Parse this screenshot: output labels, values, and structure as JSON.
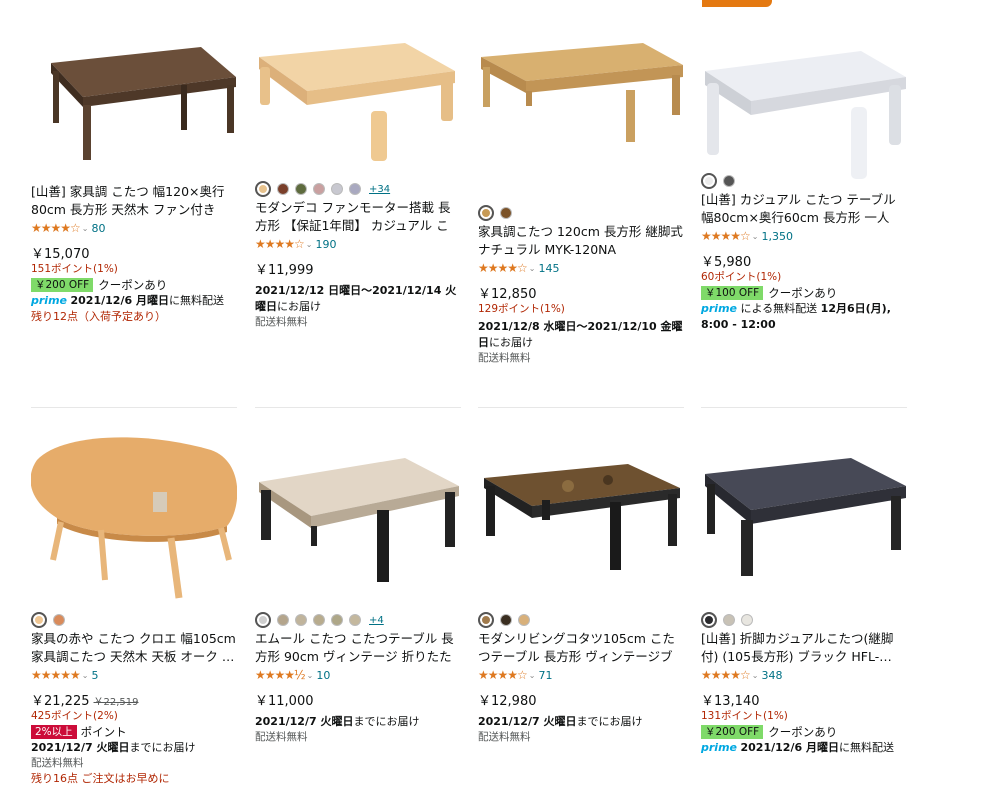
{
  "products": [
    {
      "title": "[山善] 家具調 こたつ 幅120×奥行80cm 長方形 天然木 ファン付きヒ…",
      "rating_count": "80",
      "price": "￥15,070",
      "points": "151ポイント(1%)",
      "coupon_badge": "￥200 OFF",
      "coupon_text": "クーポンあり",
      "prime_label": "prime",
      "delivery": "2021/12/6 月曜日",
      "delivery_suffix": "に無料配送",
      "stock": "残り12点（入荷予定あり）"
    },
    {
      "title": "モダンデコ ファンモーター搭載 長方形 【保証1年間】 カジュアル こた…",
      "more_colors": "+34",
      "rating_count": "190",
      "price": "￥11,999",
      "delivery": "2021/12/12 日曜日～2021/12/14 火曜日",
      "delivery_suffix": "にお届け",
      "shipping": "配送料無料"
    },
    {
      "title": "家具調こたつ 120cm 長方形 継脚式 ナチュラル MYK-120NA",
      "rating_count": "145",
      "price": "￥12,850",
      "points": "129ポイント(1%)",
      "delivery": "2021/12/8 水曜日～2021/12/10 金曜日",
      "delivery_suffix": "にお届け",
      "shipping": "配送料無料"
    },
    {
      "title": "[山善] カジュアル こたつ テーブル 幅80cm×奥行60cm 長方形 一人暮…",
      "rating_count": "1,350",
      "price": "￥5,980",
      "points": "60ポイント(1%)",
      "coupon_badge": "￥100 OFF",
      "coupon_text": "クーポンあり",
      "prime_label": "prime",
      "prime_text": "による無料配送",
      "delivery": "12月6日(月), 8:00 - 12:00"
    },
    {
      "title": "家具の赤や こたつ クロエ 幅105cm 家具調こたつ 天然木 天板 オーク …",
      "rating_count": "5",
      "price": "￥21,225",
      "strike_price": "￥22,519",
      "points": "425ポイント(2%)",
      "red_badge": "2%以上",
      "red_badge_text": "ポイント",
      "delivery": "2021/12/7 火曜日",
      "delivery_suffix": "までにお届け",
      "shipping": "配送料無料",
      "stock": "残り16点 ご注文はお早めに"
    },
    {
      "title": "エムール こたつ こたつテーブル 長方形 90cm ヴィンテージ 折りたたみ …",
      "more_colors": "+4",
      "rating_count": "10",
      "price": "￥11,000",
      "delivery": "2021/12/7 火曜日",
      "delivery_suffix": "までにお届け",
      "shipping": "配送料無料"
    },
    {
      "title": "モダンリビングコタツ105cm こたつテーブル 長方形 ヴィンテージブラ…",
      "rating_count": "71",
      "price": "￥12,980",
      "delivery": "2021/12/7 火曜日",
      "delivery_suffix": "までにお届け",
      "shipping": "配送料無料"
    },
    {
      "title": "[山善] 折脚カジュアルこたつ(継脚付) (105長方形) ブラック HFL-…",
      "rating_count": "348",
      "price": "￥13,140",
      "points": "131ポイント(1%)",
      "coupon_badge": "￥200 OFF",
      "coupon_text": "クーポンあり",
      "prime_label": "prime",
      "delivery": "2021/12/6 月曜日",
      "delivery_suffix": "に無料配送"
    }
  ],
  "stars": {
    "full": "★★★★",
    "half": "☆"
  },
  "colors": {
    "accent": "#e47911",
    "link": "#007185",
    "price_red": "#b12704",
    "coupon_green": "#7fda69",
    "prime_blue": "#00a8e1"
  }
}
